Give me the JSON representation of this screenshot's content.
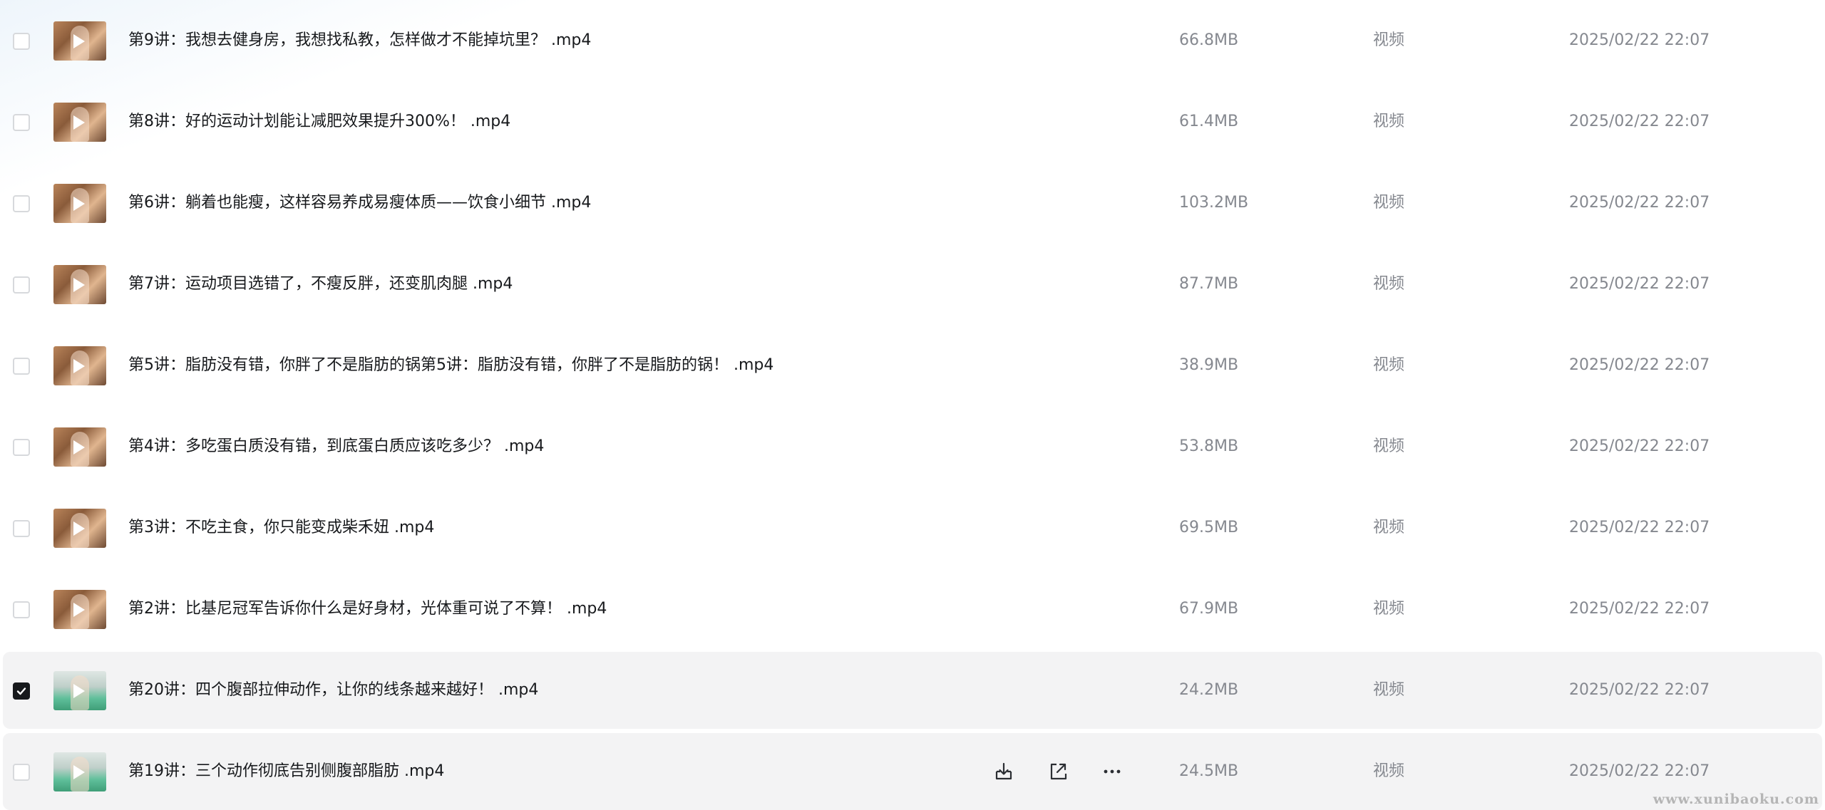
{
  "files": [
    {
      "name": "第9讲：我想去健身房，我想找私教，怎样做才不能掉坑里？ .mp4",
      "size": "66.8MB",
      "type": "视频",
      "date": "2025/02/22 22:07",
      "checked": false,
      "thumb": "warm"
    },
    {
      "name": "第8讲：好的运动计划能让减肥效果提升300%！ .mp4",
      "size": "61.4MB",
      "type": "视频",
      "date": "2025/02/22 22:07",
      "checked": false,
      "thumb": "warm"
    },
    {
      "name": "第6讲：躺着也能瘦，这样容易养成易瘦体质——饮食小细节 .mp4",
      "size": "103.2MB",
      "type": "视频",
      "date": "2025/02/22 22:07",
      "checked": false,
      "thumb": "warm"
    },
    {
      "name": "第7讲：运动项目选错了，不瘦反胖，还变肌肉腿 .mp4",
      "size": "87.7MB",
      "type": "视频",
      "date": "2025/02/22 22:07",
      "checked": false,
      "thumb": "warm"
    },
    {
      "name": "第5讲：脂肪没有错，你胖了不是脂肪的锅第5讲：脂肪没有错，你胖了不是脂肪的锅！ .mp4",
      "size": "38.9MB",
      "type": "视频",
      "date": "2025/02/22 22:07",
      "checked": false,
      "thumb": "warm"
    },
    {
      "name": "第4讲：多吃蛋白质没有错，到底蛋白质应该吃多少？ .mp4",
      "size": "53.8MB",
      "type": "视频",
      "date": "2025/02/22 22:07",
      "checked": false,
      "thumb": "warm"
    },
    {
      "name": "第3讲：不吃主食，你只能变成柴禾妞 .mp4",
      "size": "69.5MB",
      "type": "视频",
      "date": "2025/02/22 22:07",
      "checked": false,
      "thumb": "warm"
    },
    {
      "name": "第2讲：比基尼冠军告诉你什么是好身材，光体重可说了不算！ .mp4",
      "size": "67.9MB",
      "type": "视频",
      "date": "2025/02/22 22:07",
      "checked": false,
      "thumb": "warm"
    },
    {
      "name": "第20讲：四个腹部拉伸动作，让你的线条越来越好！ .mp4",
      "size": "24.2MB",
      "type": "视频",
      "date": "2025/02/22 22:07",
      "checked": true,
      "thumb": "green"
    },
    {
      "name": "第19讲：三个动作彻底告别侧腹部脂肪 .mp4",
      "size": "24.5MB",
      "type": "视频",
      "date": "2025/02/22 22:07",
      "checked": false,
      "thumb": "green",
      "hovered": true
    }
  ],
  "row_actions": [
    {
      "name": "download-icon"
    },
    {
      "name": "share-icon"
    },
    {
      "name": "more-icon"
    }
  ],
  "watermark": "www.xunibaoku.com",
  "colors": {
    "primary_text": "#17191c",
    "secondary_text": "#85888f",
    "row_highlight": "#f3f3f4",
    "checkbox_checked": "#17191c"
  }
}
